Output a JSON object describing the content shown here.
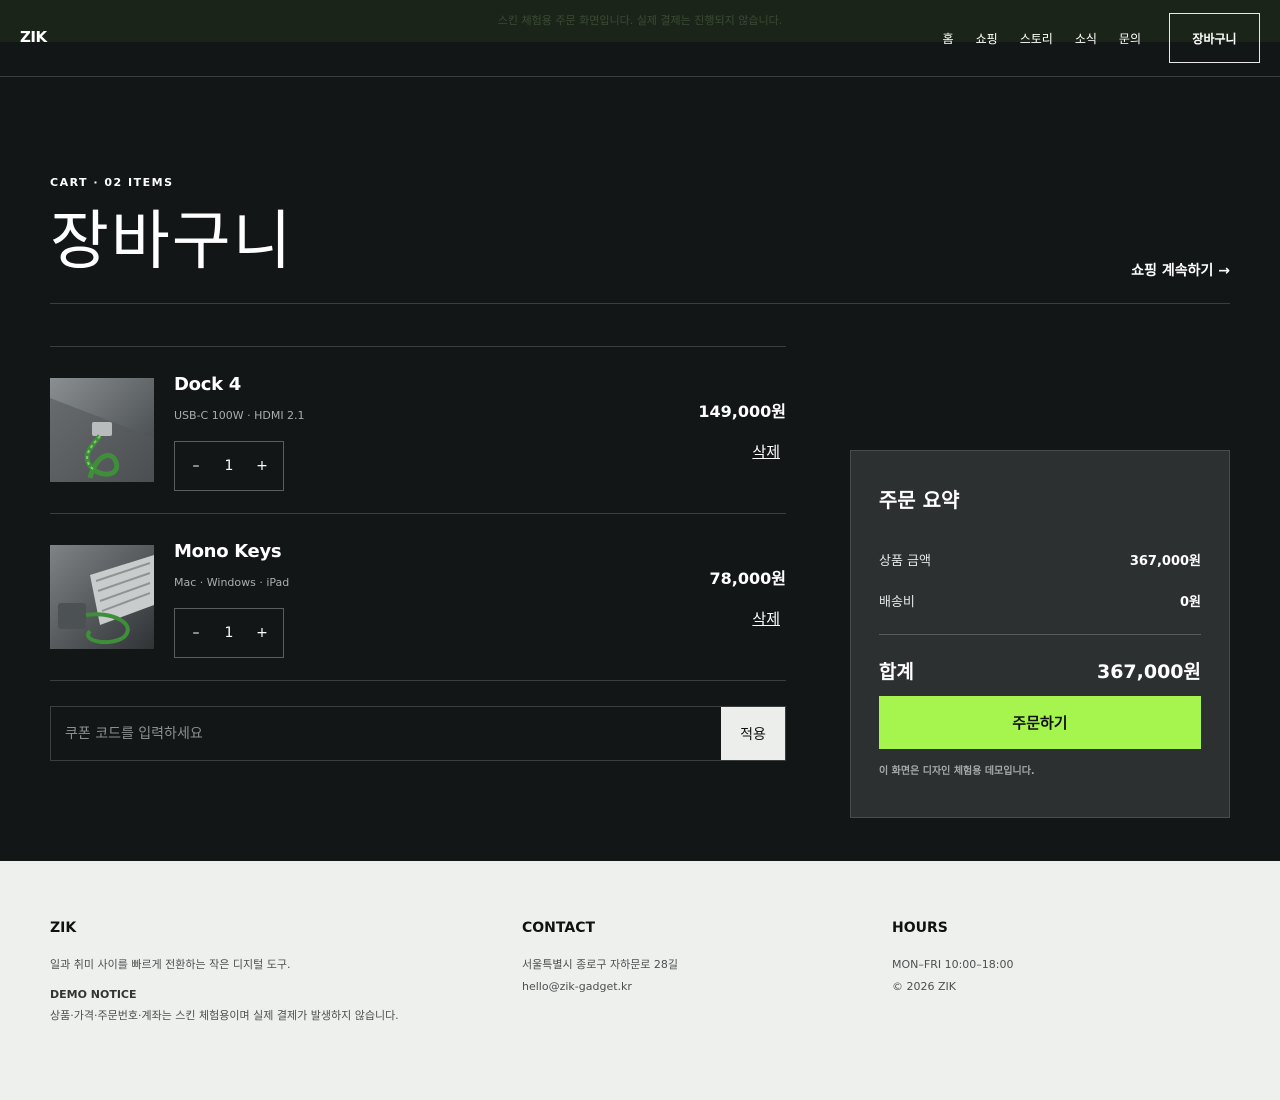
{
  "banner": {
    "text": "스킨 체험용 주문 화면입니다. 실제 결제는 진행되지 않습니다."
  },
  "header": {
    "logo": "ZIK",
    "nav": [
      "홈",
      "쇼핑",
      "스토리",
      "소식",
      "문의"
    ],
    "cart_label": "장바구니"
  },
  "page": {
    "eyebrow": "CART · 02 ITEMS",
    "title": "장바구니",
    "continue_label": "쇼핑 계속하기 →"
  },
  "items": [
    {
      "name": "Dock 4",
      "spec": "USB-C 100W · HDMI 2.1",
      "qty": "1",
      "price": "149,000원",
      "remove": "삭제"
    },
    {
      "name": "Mono Keys",
      "spec": "Mac · Windows · iPad",
      "qty": "1",
      "price": "78,000원",
      "remove": "삭제"
    }
  ],
  "qty_controls": {
    "minus": "–",
    "plus": "+"
  },
  "coupon": {
    "placeholder": "쿠폰 코드를 입력하세요",
    "apply": "적용"
  },
  "summary": {
    "title": "주문 요약",
    "subtotal_label": "상품 금액",
    "subtotal": "367,000원",
    "shipping_label": "배송비",
    "shipping": "0원",
    "total_label": "합계",
    "total": "367,000원",
    "order_label": "주문하기",
    "note": "이 화면은 디자인 체험용 데모입니다."
  },
  "footer": {
    "brand": {
      "title": "ZIK",
      "desc": "일과 취미 사이를 빠르게 전환하는 작은 디지털 도구.",
      "notice_title": "DEMO NOTICE",
      "notice_text": "상품·가격·주문번호·계좌는 스킨 체험용이며 실제 결제가 발생하지 않습니다."
    },
    "contact": {
      "title": "CONTACT",
      "address": "서울특별시 종로구 자하문로 28길",
      "email": "hello@zik-gadget.kr"
    },
    "hours": {
      "title": "HOURS",
      "time": "MON–FRI 10:00–18:00",
      "copyright": "© 2026 ZIK"
    }
  },
  "colors": {
    "bg": "#121617",
    "accent": "#a6f54e",
    "panel": "#2c3031",
    "footer": "#eef0ee"
  }
}
